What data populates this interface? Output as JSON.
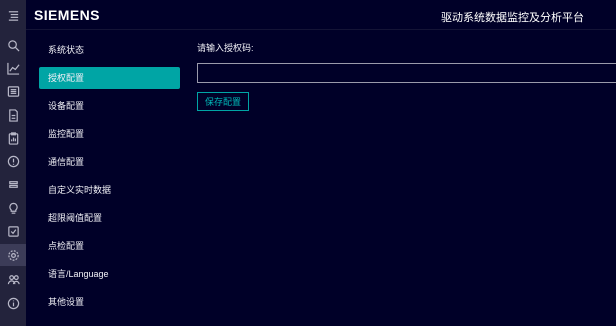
{
  "header": {
    "brand": "SIEMENS",
    "platform_title": "驱动系统数据监控及分析平台"
  },
  "rail": {
    "icons": [
      "menu-icon",
      "search-icon",
      "trend-chart-icon",
      "list-icon",
      "document-icon",
      "report-icon",
      "alert-icon",
      "storage-icon",
      "lightbulb-icon",
      "checklist-icon",
      "settings-icon",
      "users-icon",
      "info-icon"
    ],
    "active": "settings-icon"
  },
  "nav": {
    "items": [
      {
        "label": "系统状态"
      },
      {
        "label": "授权配置"
      },
      {
        "label": "设备配置"
      },
      {
        "label": "监控配置"
      },
      {
        "label": "通信配置"
      },
      {
        "label": "自定义实时数据"
      },
      {
        "label": "超限阈值配置"
      },
      {
        "label": "点检配置"
      },
      {
        "label": "语言/Language"
      },
      {
        "label": "其他设置"
      }
    ],
    "active_label": "授权配置"
  },
  "main": {
    "field_label": "请输入授权码:",
    "auth_code_value": "",
    "save_label": "保存配置"
  },
  "colors": {
    "background": "#000028",
    "rail": "#23233c",
    "accent": "#00a5a5"
  }
}
